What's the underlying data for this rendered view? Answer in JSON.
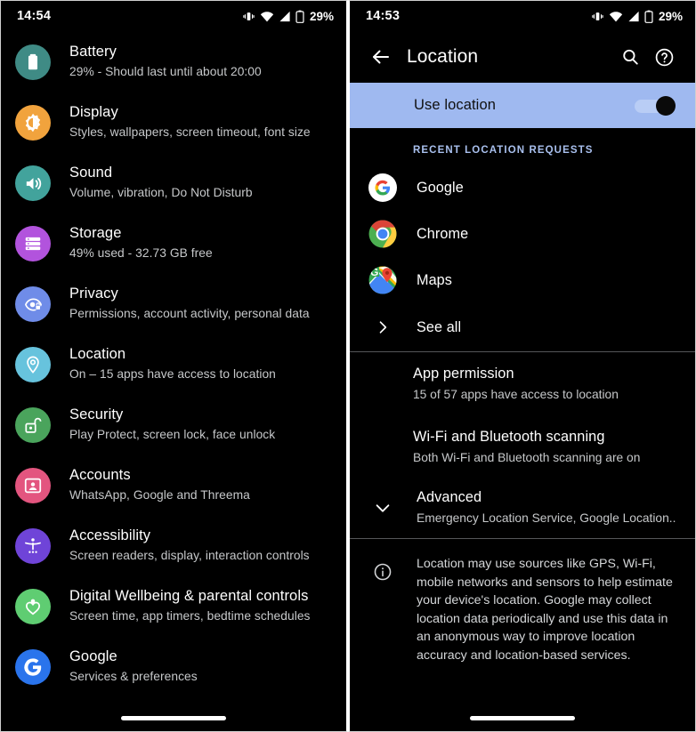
{
  "left_phone": {
    "status_bar": {
      "time": "14:54",
      "battery_percent": "29%",
      "icons": [
        "vibrate-icon",
        "wifi-icon",
        "signal-icon",
        "battery-icon"
      ]
    },
    "settings_items": [
      {
        "icon": "battery-icon",
        "icon_color": "#3f8b85",
        "title": "Battery",
        "subtitle": "29% - Should last until about 20:00"
      },
      {
        "icon": "brightness-icon",
        "icon_color": "#f1a33d",
        "title": "Display",
        "subtitle": "Styles, wallpapers, screen timeout, font size"
      },
      {
        "icon": "volume-icon",
        "icon_color": "#42a39c",
        "title": "Sound",
        "subtitle": "Volume, vibration, Do Not Disturb"
      },
      {
        "icon": "storage-icon",
        "icon_color": "#b253dd",
        "title": "Storage",
        "subtitle": "49% used - 32.73 GB free"
      },
      {
        "icon": "privacy-eye-lock-icon",
        "icon_color": "#6f8ce8",
        "title": "Privacy",
        "subtitle": "Permissions, account activity, personal data"
      },
      {
        "icon": "location-pin-icon",
        "icon_color": "#67c3dd",
        "title": "Location",
        "subtitle": "On – 15 apps have access to location"
      },
      {
        "icon": "unlock-icon",
        "icon_color": "#4aa45c",
        "title": "Security",
        "subtitle": "Play Protect, screen lock, face unlock"
      },
      {
        "icon": "account-portrait-icon",
        "icon_color": "#e3557f",
        "title": "Accounts",
        "subtitle": "WhatsApp, Google and Threema"
      },
      {
        "icon": "accessibility-icon",
        "icon_color": "#6f44d8",
        "title": "Accessibility",
        "subtitle": "Screen readers, display, interaction controls"
      },
      {
        "icon": "wellbeing-heart-icon",
        "icon_color": "#5fcd72",
        "title": "Digital Wellbeing & parental controls",
        "subtitle": "Screen time, app timers, bedtime schedules"
      },
      {
        "icon": "google-g-icon",
        "icon_color": "#2a74ec",
        "title": "Google",
        "subtitle": "Services & preferences"
      }
    ]
  },
  "right_phone": {
    "status_bar": {
      "time": "14:53",
      "battery_percent": "29%",
      "icons": [
        "vibrate-icon",
        "wifi-icon",
        "signal-icon",
        "battery-icon"
      ]
    },
    "app_bar": {
      "back_icon": "arrow-back-icon",
      "title": "Location",
      "search_icon": "search-icon",
      "help_icon": "help-circle-icon"
    },
    "use_location": {
      "label": "Use location",
      "enabled": true,
      "highlight_color": "#9fb9f0"
    },
    "recent_section": {
      "header": "RECENT LOCATION REQUESTS",
      "header_color": "#a9c0ee",
      "apps": [
        {
          "name": "Google",
          "icon": "google-g-icon"
        },
        {
          "name": "Chrome",
          "icon": "chrome-icon"
        },
        {
          "name": "Maps",
          "icon": "google-maps-icon"
        }
      ],
      "see_all": {
        "label": "See all",
        "icon": "chevron-right-icon"
      }
    },
    "preferences": [
      {
        "title": "App permission",
        "subtitle": "15 of 57 apps have access to location"
      },
      {
        "title": "Wi-Fi and Bluetooth scanning",
        "subtitle": "Both Wi-Fi and Bluetooth scanning are on"
      }
    ],
    "advanced": {
      "icon": "chevron-down-icon",
      "title": "Advanced",
      "subtitle": "Emergency Location Service, Google Location.."
    },
    "footnote": {
      "icon": "info-icon",
      "text": "Location may use sources like GPS, Wi-Fi, mobile networks and sensors to help estimate your device's location. Google may collect location data periodically and use this data in an anonymous way to improve location accuracy and location-based services."
    }
  }
}
